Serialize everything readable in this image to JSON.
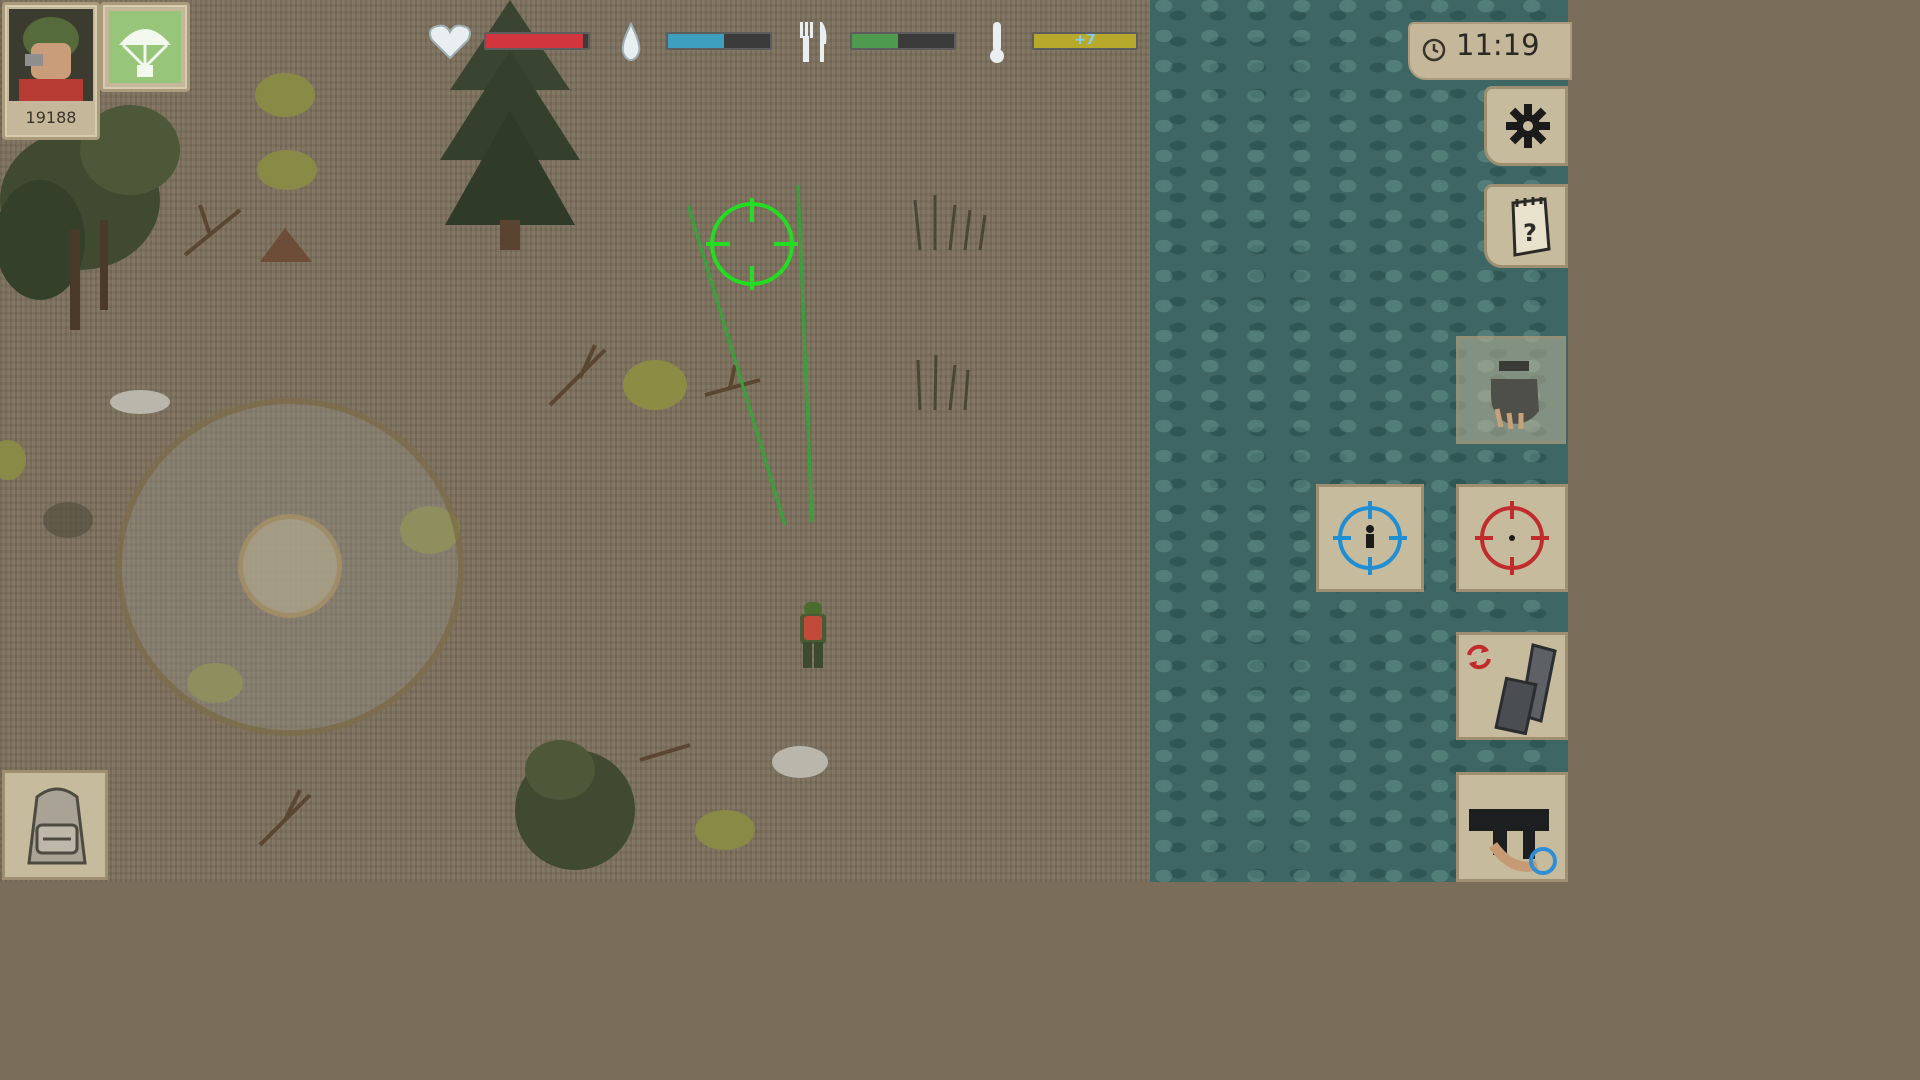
{
  "player": {
    "score": "19188"
  },
  "clock": {
    "time": "11:19"
  },
  "stats": {
    "health": {
      "fraction": 0.95,
      "color": "#d1363f"
    },
    "thirst": {
      "fraction": 0.55,
      "color": "#3f9fbf"
    },
    "hunger": {
      "fraction": 0.45,
      "color": "#4e9a4e"
    },
    "temperature": {
      "label": "+7",
      "color": "#b7a92c"
    }
  },
  "icons": {
    "heart": "heart-icon",
    "water": "water-drop-icon",
    "food": "fork-knife-icon",
    "temperature": "thermometer-icon",
    "clock": "clock-icon",
    "settings": "gear-icon",
    "quests": "notepad-icon",
    "interact": "hand-icon",
    "aim_player": "blue-crosshair-icon",
    "aim_target": "red-crosshair-icon",
    "reload": "reload-weapon-icon",
    "switch_weapon": "rifle-switch-icon",
    "backpack": "backpack-icon",
    "supply_drop": "parachute-icon"
  },
  "colors": {
    "aim_reticle": "#22dd22",
    "grass": "#7c705c",
    "water": "#3d6664"
  }
}
